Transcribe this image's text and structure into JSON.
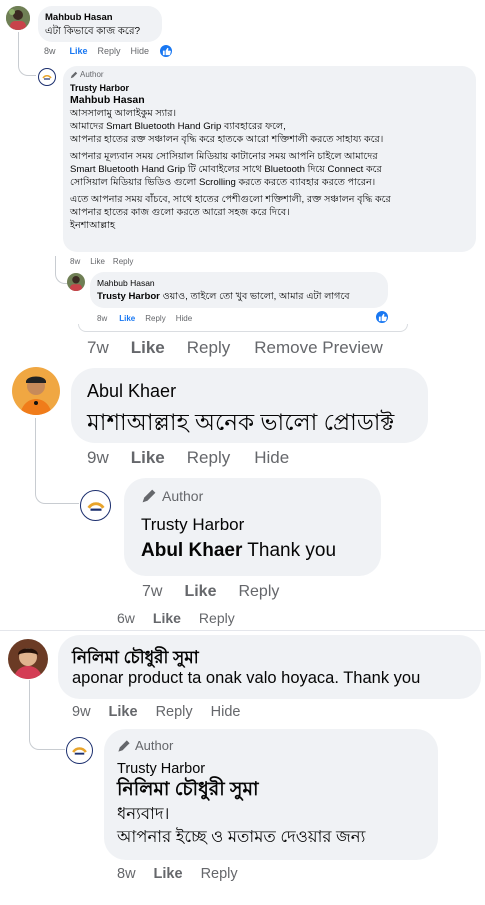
{
  "comment1": {
    "author": "Mahbub Hasan",
    "text": "এটা কিভাবে কাজ করে?",
    "time": "8w",
    "like": "Like",
    "reply": "Reply",
    "hide": "Hide",
    "avatar_icon": "user-avatar-icon"
  },
  "reply1": {
    "author_badge": "Author",
    "page_name": "Trusty Harbor",
    "mention": "Mahbub Hasan",
    "paragraphs": [
      [
        "আসসালামু আলাইকুম স্যার।",
        "আমাদের Smart Bluetooth Hand Grip ব্যাবহারের ফলে,",
        "আপনার হাতের রক্ত সঞ্চালন বৃদ্ধি করে হাতকে আরো শক্তিশালী করতে সাহায্য করে।"
      ],
      [
        "আপনার মূল্যবান সময় সোসিয়াল মিডিয়ায় কাটানোর সময় আপনি চাইলে আমাদের",
        "Smart Bluetooth Hand Grip টি মোবাইলের সাথে Bluetooth দিয়ে Connect করে",
        "সোসিয়াল মিডিয়ার ভিডিও গুলো Scrolling করতে করতে ব্যাবহার করতে পারেন।"
      ],
      [
        "এতে আপনার সময় বাঁচবে, সাথে হাতের পেশীগুলো শক্তিশালী, রক্ত সঞ্চালন বৃদ্ধি করে",
        "আপনার হাতের কাজ গুলো করতে আরো সহজ করে দিবে।",
        "ইনশাআল্লাহ"
      ]
    ],
    "time": "8w",
    "like": "Like",
    "reply": "Reply"
  },
  "reply2": {
    "author": "Mahbub Hasan",
    "mention": "Trusty Harbor",
    "text": " ওয়াও, তাইলে তো খুব ভালো, আমার এটা লাগবে",
    "time": "8w",
    "like": "Like",
    "reply": "Reply",
    "hide": "Hide"
  },
  "thread1_actions": {
    "time": "7w",
    "like": "Like",
    "reply": "Reply",
    "remove_preview": "Remove Preview"
  },
  "comment2": {
    "author": "Abul Khaer",
    "text": "মাশাআল্লাহ অনেক ভালো প্রোডাক্ট",
    "time": "9w",
    "like": "Like",
    "reply": "Reply",
    "hide": "Hide"
  },
  "reply3": {
    "author_badge": "Author",
    "page_name": "Trusty Harbor",
    "mention": "Abul Khaer",
    "text": " Thank you",
    "time": "7w",
    "like": "Like",
    "reply": "Reply"
  },
  "thread2_actions": {
    "time": "6w",
    "like": "Like",
    "reply": "Reply"
  },
  "comment3": {
    "author": "নিলিমা চৌধুরী সুমা",
    "text": "aponar product ta onak valo hoyaca. Thank you",
    "time": "9w",
    "like": "Like",
    "reply": "Reply",
    "hide": "Hide"
  },
  "reply4": {
    "author_badge": "Author",
    "page_name": "Trusty Harbor",
    "mention": "নিলিমা চৌধুরী সুমা",
    "lines": [
      "ধন্যবাদ।",
      "আপনার ইচ্ছে ও মতামত দেওয়ার জন্য"
    ],
    "time": "8w",
    "like": "Like",
    "reply": "Reply"
  },
  "colors": {
    "bubble": "#f0f2f5",
    "meta": "#65676b",
    "like_blue": "#1877f2"
  }
}
